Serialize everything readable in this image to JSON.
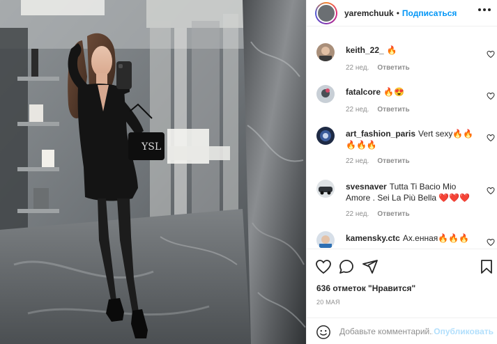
{
  "post": {
    "username": "yaremchuuk",
    "separator": "•",
    "follow_label": "Подписаться",
    "more_icon": "more-horizontal-icon"
  },
  "comments": [
    {
      "user": "keith_22_",
      "text": "🔥",
      "time": "22 нед.",
      "reply": "Ответить"
    },
    {
      "user": "fatalcore",
      "text": "🔥😍",
      "time": "22 нед.",
      "reply": "Ответить"
    },
    {
      "user": "art_fashion_paris",
      "text": "Vert sexy🔥🔥🔥🔥🔥",
      "time": "22 нед.",
      "reply": "Ответить"
    },
    {
      "user": "svesnaver",
      "text": "Tutta Ti Bacio Mio Amore . Sei La Più Bella ❤️❤️❤️",
      "time": "22 нед.",
      "reply": "Ответить"
    },
    {
      "user": "kamensky.ctc",
      "text": "Ах.енная🔥🔥🔥",
      "time": "",
      "reply": ""
    }
  ],
  "actions": {
    "icons": [
      "heart-icon",
      "comment-icon",
      "share-icon",
      "bookmark-icon"
    ],
    "likes": "636 отметок \"Нравится\"",
    "date": "20 мая"
  },
  "add_comment": {
    "placeholder": "Добавьте комментарий...",
    "publish_label": "Опубликовать"
  },
  "colors": {
    "accent": "#0095f6",
    "publish_disabled": "#b2dffc",
    "muted": "#8e8e8e",
    "text": "#262626"
  }
}
